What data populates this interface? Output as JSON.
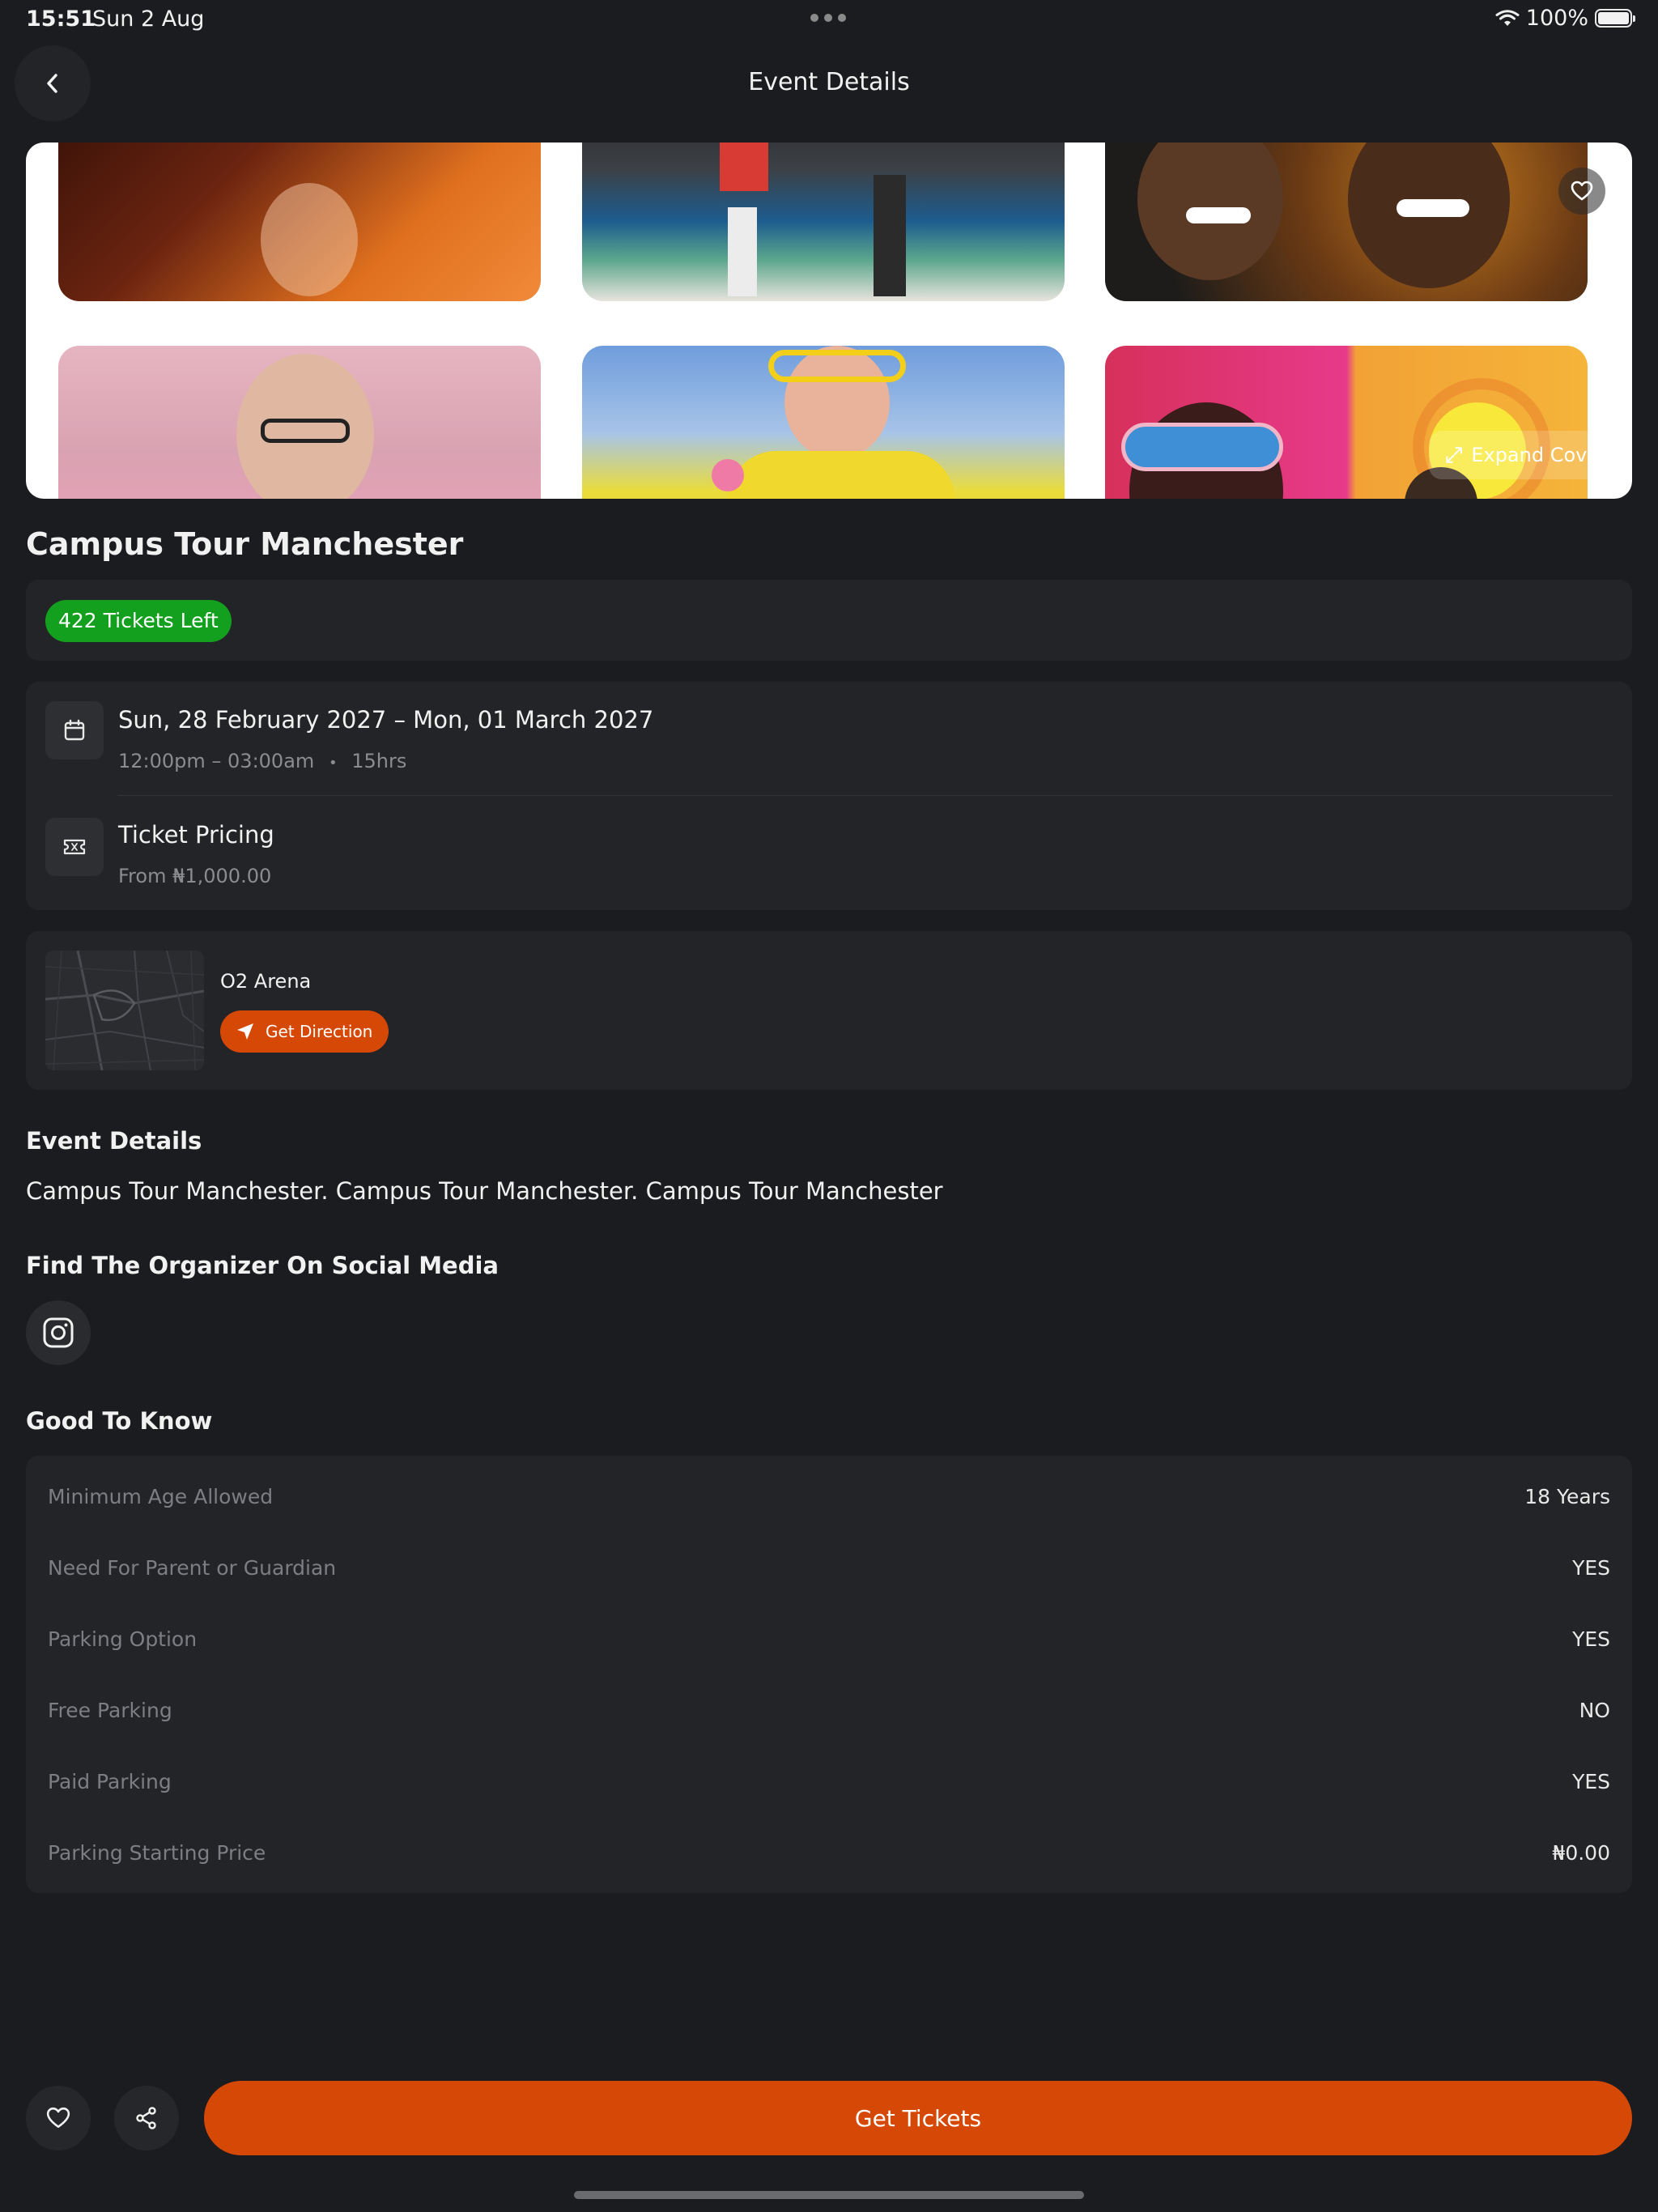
{
  "status_bar": {
    "time": "15:51",
    "date": "Sun 2 Aug",
    "battery": "100%",
    "battery_level": 1.0
  },
  "header": {
    "title": "Event Details",
    "back_icon": "chevron-left-icon"
  },
  "gallery": {
    "expand_label": "Expand Cover"
  },
  "event": {
    "name": "Campus Tour Manchester",
    "tickets_left": "422 Tickets Left"
  },
  "schedule": {
    "date_range": "Sun, 28 February 2027 – Mon, 01 March 2027",
    "time_range": "12:00pm – 03:00am",
    "separator": "•",
    "duration": "15hrs"
  },
  "pricing": {
    "title": "Ticket Pricing",
    "from": "From ₦1,000.00"
  },
  "venue": {
    "name": "O2 Arena",
    "direction_label": "Get Direction"
  },
  "details": {
    "heading": "Event Details",
    "description": "Campus Tour Manchester. Campus Tour Manchester. Campus Tour Manchester"
  },
  "social": {
    "heading": "Find The Organizer On Social Media"
  },
  "good_to_know": {
    "heading": "Good To Know",
    "rows": [
      {
        "label": "Minimum Age Allowed",
        "value": "18 Years"
      },
      {
        "label": "Need For Parent or Guardian",
        "value": "YES"
      },
      {
        "label": "Parking Option",
        "value": "YES"
      },
      {
        "label": "Free Parking",
        "value": "NO"
      },
      {
        "label": "Paid Parking",
        "value": "YES"
      },
      {
        "label": "Parking Starting Price",
        "value": "₦0.00"
      }
    ]
  },
  "footer": {
    "cta_label": "Get Tickets"
  },
  "colors": {
    "background": "#1b1c1f",
    "card": "#232427",
    "accent": "#d64806",
    "success": "#14a01f",
    "muted_text": "#7d7e83"
  }
}
